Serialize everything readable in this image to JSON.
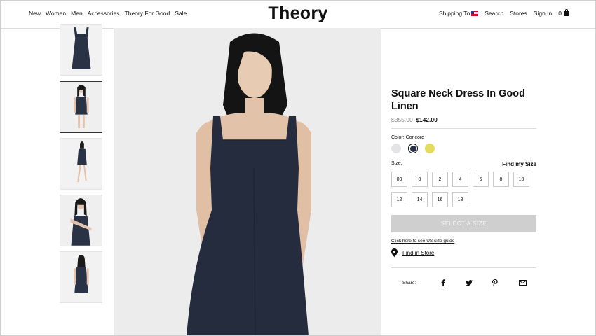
{
  "header": {
    "nav_left": [
      "New",
      "Women",
      "Men",
      "Accessories",
      "Theory For Good",
      "Sale"
    ],
    "logo": "Theory",
    "shipping": "Shipping To",
    "search": "Search",
    "stores": "Stores",
    "sign_in": "Sign In",
    "bag_count": "0"
  },
  "product": {
    "title": "Square Neck Dress In Good Linen",
    "old_price": "$355.00",
    "new_price": "$142.00",
    "color_label": "Color: Concord",
    "swatches": [
      {
        "name": "light-grey",
        "color": "#e4e4e6"
      },
      {
        "name": "concord",
        "color": "#28324a",
        "selected": true
      },
      {
        "name": "yellow",
        "color": "#e4dc5c"
      }
    ],
    "size_label": "Size:",
    "find_my_size": "Find my Size",
    "sizes": [
      "00",
      "0",
      "2",
      "4",
      "6",
      "8",
      "10",
      "12",
      "14",
      "16",
      "18"
    ],
    "cta": "SELECT A SIZE",
    "size_guide": "Click here to see US size guide",
    "find_in_store": "Find in Store",
    "share_label": "Share:",
    "share_icons": [
      "facebook-icon",
      "twitter-icon",
      "pinterest-icon",
      "email-icon"
    ]
  },
  "colors": {
    "dress": "#252c3d",
    "background": "#ececec",
    "cta_bg": "#cfcfcf"
  }
}
